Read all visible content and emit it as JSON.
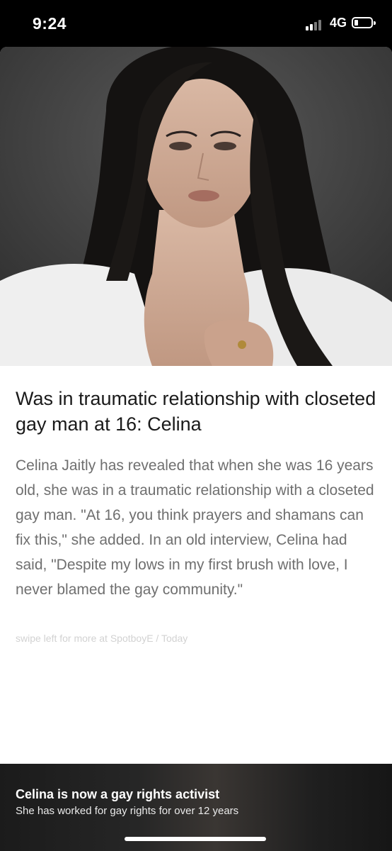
{
  "status_bar": {
    "time": "9:24",
    "network": "4G"
  },
  "article": {
    "headline": "Was in traumatic relationship with closeted gay man at 16: Celina",
    "body": "Celina Jaitly has revealed that when she was 16 years old, she was in a traumatic relationship with a closeted gay man. \"At 16, you think prayers and shamans can fix this,\" she added. In an old interview, Celina had said, \"Despite my lows in my first brush with love, I never blamed the gay community.\"",
    "source": "swipe left for more at SpotboyE / Today"
  },
  "footer": {
    "title": "Celina is now a gay rights activist",
    "subtitle": "She has worked for gay rights for over 12 years"
  },
  "colors": {
    "headline": "#1a1a1a",
    "body": "#6f6f6f",
    "source": "#d2d2d2",
    "background": "#000000"
  }
}
